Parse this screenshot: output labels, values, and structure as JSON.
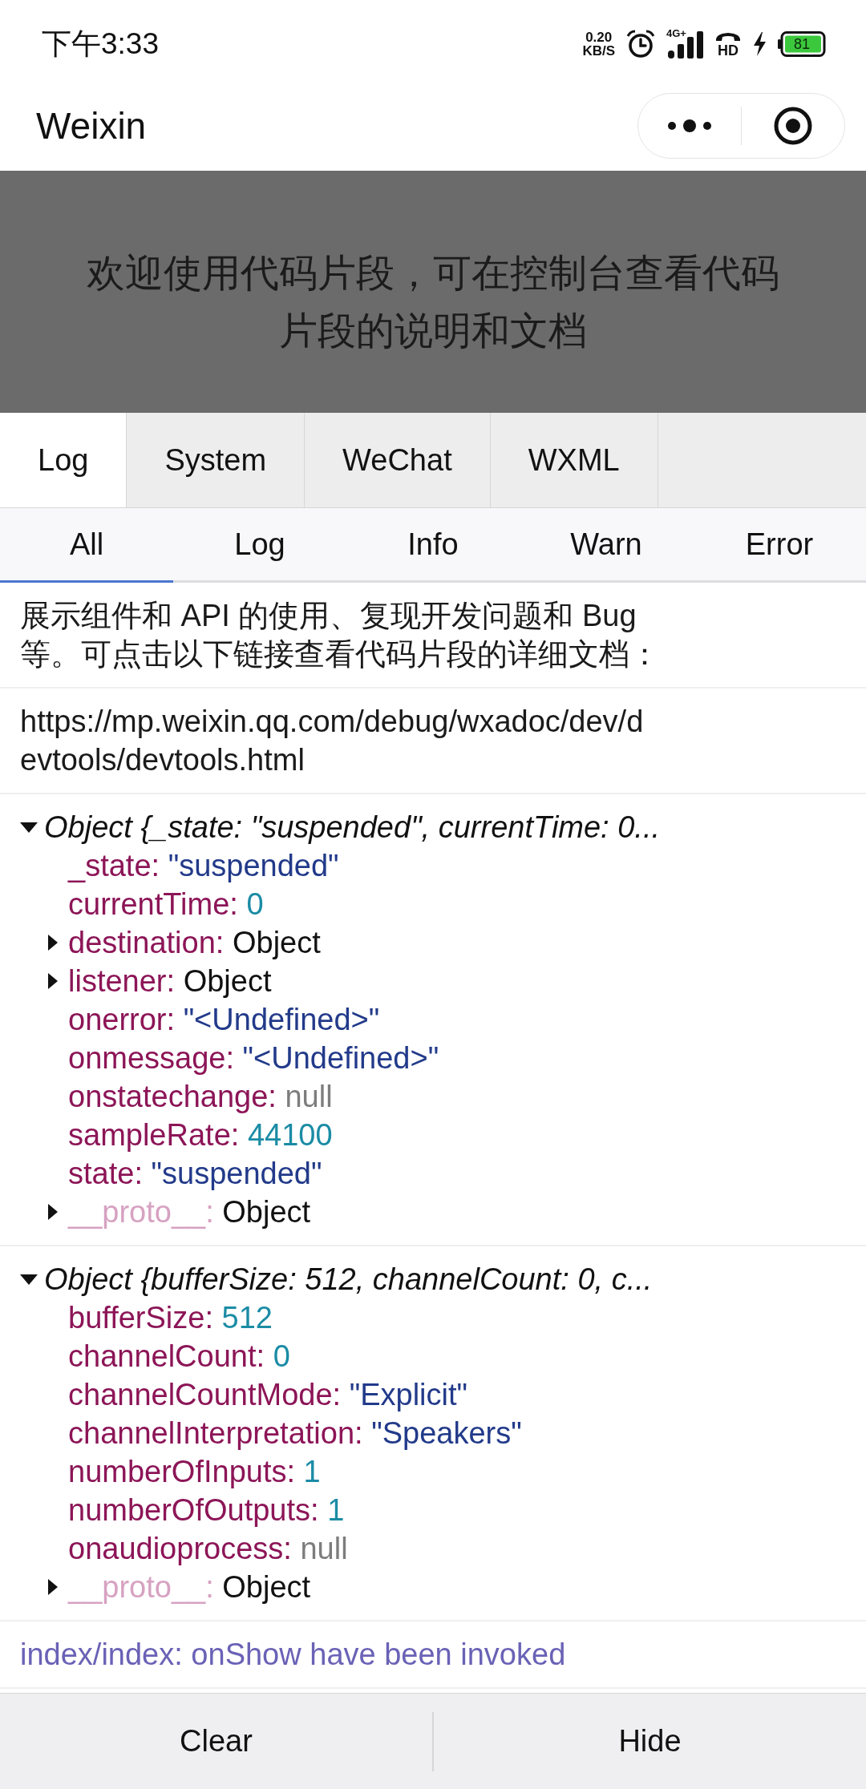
{
  "status_bar": {
    "time": "下午3:33",
    "speed": "0.20",
    "speed_unit": "KB/S",
    "network_type": "4G+",
    "call_quality": "HD",
    "battery": "81"
  },
  "nav_bar": {
    "title": "Weixin"
  },
  "banner": {
    "text": "欢迎使用代码片段，可在控制台查看代码片段的说明和文档"
  },
  "tabs": [
    {
      "label": "Log",
      "selected": true
    },
    {
      "label": "System",
      "selected": false
    },
    {
      "label": "WeChat",
      "selected": false
    },
    {
      "label": "WXML",
      "selected": false
    }
  ],
  "filters": [
    {
      "label": "All",
      "selected": true
    },
    {
      "label": "Log",
      "selected": false
    },
    {
      "label": "Info",
      "selected": false
    },
    {
      "label": "Warn",
      "selected": false
    },
    {
      "label": "Error",
      "selected": false
    }
  ],
  "log": [
    {
      "kind": "text",
      "text": "展示组件和 API 的使用、复现开发问题和 Bug 等。可点击以下链接查看代码片段的详细文档："
    },
    {
      "kind": "url",
      "text": "https://mp.weixin.qq.com/debug/wxadoc/dev/devtools/devtools.html"
    },
    {
      "kind": "object",
      "expanded": true,
      "summary": "Object {_state: \"suspended\", currentTime: 0...",
      "properties": [
        {
          "key": "_state:",
          "kind": "string",
          "value": "\"suspended\"",
          "dimmed": false
        },
        {
          "key": "currentTime:",
          "kind": "number",
          "value": "0",
          "dimmed": false
        },
        {
          "key": "destination:",
          "kind": "object",
          "value": "Object",
          "expanded": false,
          "dimmed": false
        },
        {
          "key": "listener:",
          "kind": "object",
          "value": "Object",
          "expanded": false,
          "dimmed": false
        },
        {
          "key": "onerror:",
          "kind": "string",
          "value": "\"<Undefined>\"",
          "dimmed": false
        },
        {
          "key": "onmessage:",
          "kind": "string",
          "value": "\"<Undefined>\"",
          "dimmed": false
        },
        {
          "key": "onstatechange:",
          "kind": "null",
          "value": "null",
          "dimmed": false
        },
        {
          "key": "sampleRate:",
          "kind": "number",
          "value": "44100",
          "dimmed": false
        },
        {
          "key": "state:",
          "kind": "string",
          "value": "\"suspended\"",
          "dimmed": false
        },
        {
          "key": "__proto__:",
          "kind": "object",
          "value": "Object",
          "expanded": false,
          "dimmed": true
        }
      ]
    },
    {
      "kind": "object",
      "expanded": true,
      "summary": "Object {bufferSize: 512, channelCount: 0, c...",
      "properties": [
        {
          "key": "bufferSize:",
          "kind": "number",
          "value": "512",
          "dimmed": false
        },
        {
          "key": "channelCount:",
          "kind": "number",
          "value": "0",
          "dimmed": false
        },
        {
          "key": "channelCountMode:",
          "kind": "string",
          "value": "\"Explicit\"",
          "dimmed": false
        },
        {
          "key": "channelInterpretation:",
          "kind": "string",
          "value": "\"Speakers\"",
          "dimmed": false
        },
        {
          "key": "numberOfInputs:",
          "kind": "number",
          "value": "1",
          "dimmed": false
        },
        {
          "key": "numberOfOutputs:",
          "kind": "number",
          "value": "1",
          "dimmed": false
        },
        {
          "key": "onaudioprocess:",
          "kind": "null",
          "value": "null",
          "dimmed": false
        },
        {
          "key": "__proto__:",
          "kind": "object",
          "value": "Object",
          "expanded": false,
          "dimmed": true
        }
      ]
    },
    {
      "kind": "info",
      "text": "index/index: onShow have been invoked"
    }
  ],
  "bottom_bar": {
    "buttons": [
      "Clear",
      "Hide"
    ]
  }
}
